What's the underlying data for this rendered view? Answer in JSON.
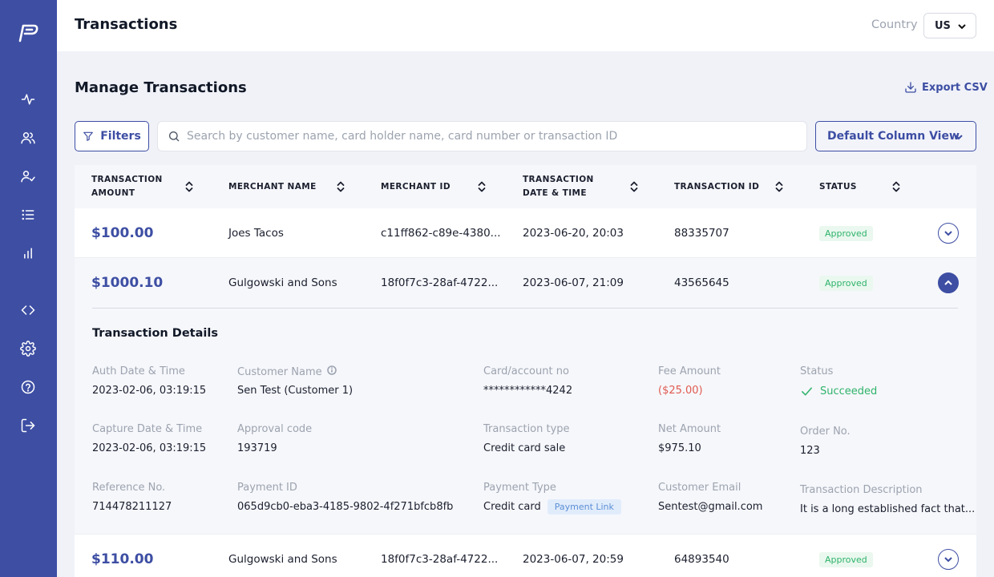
{
  "header": {
    "title": "Transactions",
    "country_label": "Country",
    "country_value": "US"
  },
  "sidebar": {
    "icons": [
      "activity-icon",
      "users-icon",
      "user-check-icon",
      "list-icon",
      "bar-chart-icon",
      "code-icon",
      "settings-icon",
      "help-icon",
      "logout-icon"
    ]
  },
  "main": {
    "title": "Manage Transactions",
    "export_label": "Export CSV",
    "filters_label": "Filters",
    "search_placeholder": "Search by customer name, card holder name, card number or transaction ID",
    "column_view_label": "Default Column View"
  },
  "table": {
    "columns": [
      {
        "line1": "TRANSACTION",
        "line2": "AMOUNT"
      },
      {
        "line1": "MERCHANT NAME",
        "line2": ""
      },
      {
        "line1": "MERCHANT ID",
        "line2": ""
      },
      {
        "line1": "TRANSACTION",
        "line2": "DATE & TIME"
      },
      {
        "line1": "TRANSACTION ID",
        "line2": ""
      },
      {
        "line1": "STATUS",
        "line2": ""
      }
    ],
    "rows": [
      {
        "amount": "$100.00",
        "merchant": "Joes Tacos",
        "merchant_id": "c11ff862-c89e-4380...",
        "datetime": "2023-06-20, 20:03",
        "txn_id": "88335707",
        "status": "Approved"
      },
      {
        "amount": "$1000.10",
        "merchant": "Gulgowski and Sons",
        "merchant_id": "18f0f7c3-28af-4722...",
        "datetime": "2023-06-07, 21:09",
        "txn_id": "43565645",
        "status": "Approved"
      },
      {
        "amount": "$110.00",
        "merchant": "Gulgowski and Sons",
        "merchant_id": "18f0f7c3-28af-4722...",
        "datetime": "2023-06-07, 20:59",
        "txn_id": "64893540",
        "status": "Approved"
      }
    ]
  },
  "details": {
    "title": "Transaction Details",
    "auth_label": "Auth Date & Time",
    "auth_value": "2023-02-06, 03:19:15",
    "customer_label": "Customer Name",
    "customer_value": "Sen Test (Customer 1)",
    "card_label": "Card/account no",
    "card_value": "************4242",
    "fee_label": "Fee Amount",
    "fee_value": "($25.00)",
    "status_label": "Status",
    "status_value": "Succeeded",
    "capture_label": "Capture Date & Time",
    "capture_value": "2023-02-06, 03:19:15",
    "approval_label": "Approval code",
    "approval_value": "193719",
    "type_label": "Transaction type",
    "type_value": "Credit card sale",
    "net_label": "Net Amount",
    "net_value": "$975.10",
    "order_label": "Order No.",
    "order_value": "123",
    "ref_label": "Reference No.",
    "ref_value": "714478211127",
    "payment_id_label": "Payment ID",
    "payment_id_value": "065d9cb0-eba3-4185-9802-4f271bfcb8fb",
    "payment_type_label": "Payment Type",
    "payment_type_value": "Credit card",
    "payment_type_badge": "Payment Link",
    "email_label": "Customer Email",
    "email_value": "Sentest@gmail.com",
    "desc_label": "Transaction Description",
    "desc_value": "It is a long established fact that..."
  },
  "colors": {
    "brand": "#3d4ea3",
    "success": "#2fb36a",
    "negative": "#e05a4f"
  }
}
